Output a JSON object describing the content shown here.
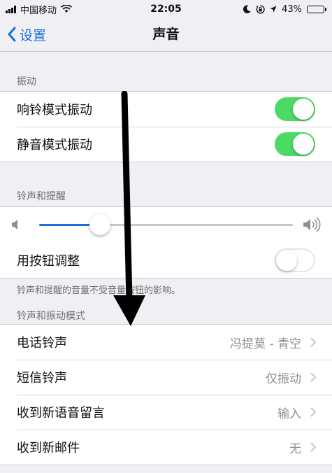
{
  "status_bar": {
    "carrier": "中国移动",
    "time": "22:05",
    "battery_percent": "43%",
    "battery_level": 0.43,
    "battery_color": "#4cd964"
  },
  "nav": {
    "back_label": "设置",
    "title": "声音"
  },
  "vibrate_section": {
    "header": "振动",
    "rows": [
      {
        "label": "响铃模式振动",
        "toggle": true
      },
      {
        "label": "静音模式振动",
        "toggle": true
      }
    ]
  },
  "ringer_section": {
    "header": "铃声和提醒",
    "volume_level": 0.24,
    "adjust_with_buttons": {
      "label": "用按钮调整",
      "toggle": false
    },
    "footnote": "铃声和提醒的音量不受音量按钮的影响。"
  },
  "patterns_section": {
    "header": "铃声和振动模式",
    "rows": [
      {
        "label": "电话铃声",
        "value": "冯提莫 - 青空"
      },
      {
        "label": "短信铃声",
        "value": "仅振动"
      },
      {
        "label": "收到新语音留言",
        "value": "输入"
      },
      {
        "label": "收到新邮件",
        "value": "无"
      }
    ]
  },
  "colors": {
    "accent": "#1a6fe0",
    "toggle_on": "#4cd964",
    "background": "#efeff4"
  },
  "icons": [
    "wifi-icon",
    "moon-icon",
    "orientation-lock-icon",
    "location-icon",
    "battery-icon",
    "chevron-left-icon",
    "volume-low-icon",
    "volume-high-icon",
    "chevron-right-icon"
  ]
}
